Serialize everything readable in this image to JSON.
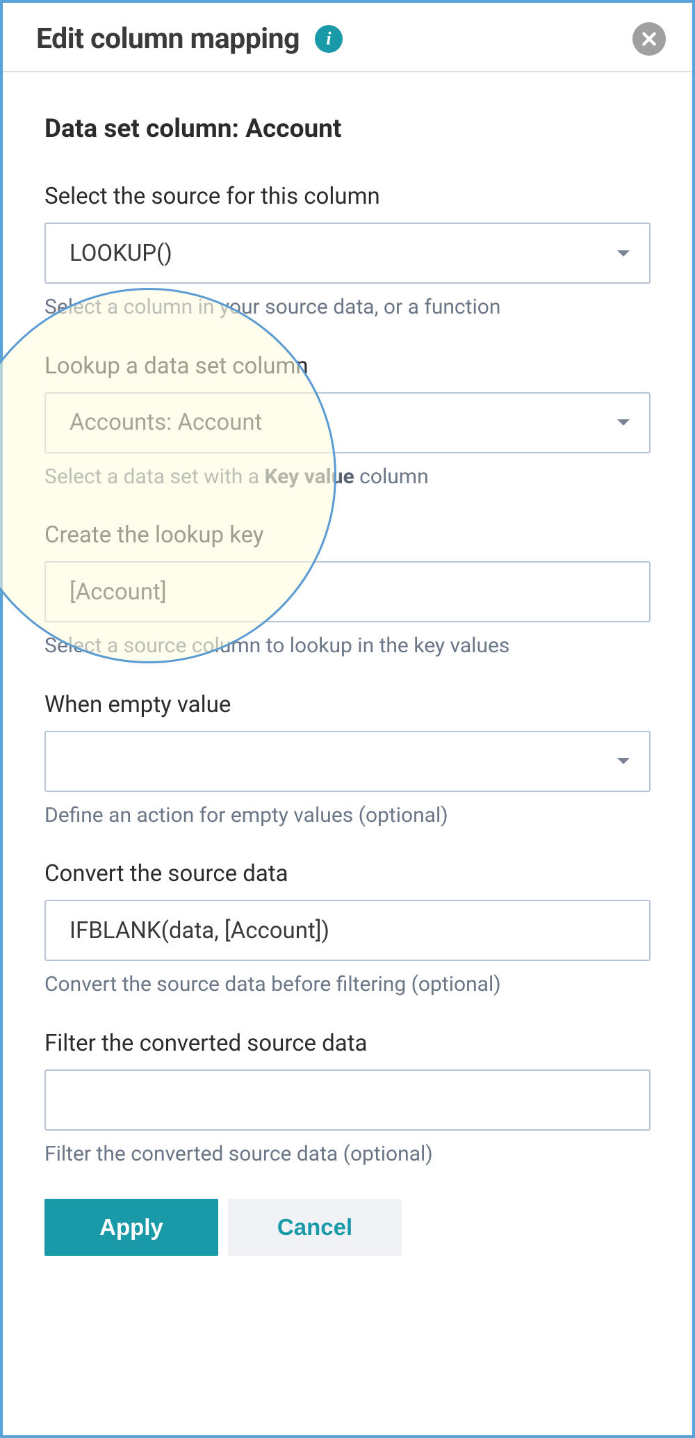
{
  "header": {
    "title": "Edit column mapping"
  },
  "heading": "Data set column: Account",
  "fields": {
    "source": {
      "label": "Select the source for this column",
      "value": "LOOKUP()",
      "helper": "Select a column in your source data, or a function"
    },
    "lookup_column": {
      "label": "Lookup a data set column",
      "value": "Accounts: Account",
      "helper_pre": "Select a data set with a ",
      "helper_emph": "Key value",
      "helper_post": " column"
    },
    "lookup_key": {
      "label": "Create the lookup key",
      "value": "[Account]",
      "helper": "Select a source column to lookup in the key values"
    },
    "empty_value": {
      "label": "When empty value",
      "value": "",
      "helper": "Define an action for empty values (optional)"
    },
    "convert": {
      "label": "Convert the source data",
      "value": "IFBLANK(data, [Account])",
      "helper": "Convert the source data before filtering (optional)"
    },
    "filter": {
      "label": "Filter the converted source data",
      "value": "",
      "helper": "Filter the converted source data (optional)"
    }
  },
  "buttons": {
    "apply": "Apply",
    "cancel": "Cancel"
  }
}
